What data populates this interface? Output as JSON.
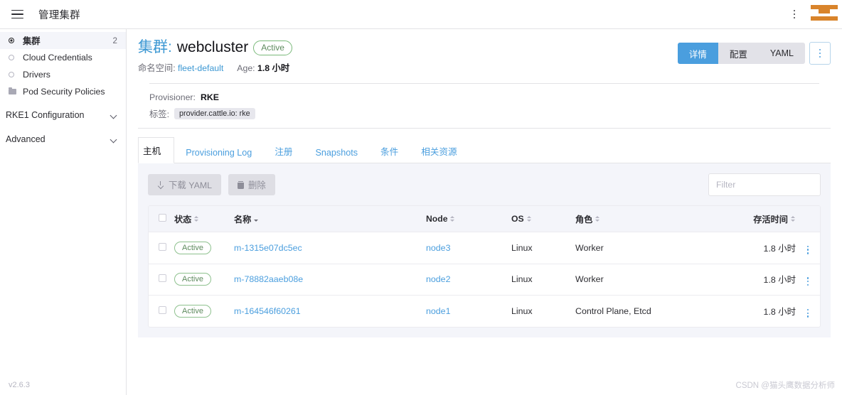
{
  "topbar": {
    "menu_icon": "hamburger-icon",
    "title": "管理集群",
    "kebab_icon": "vertical-dots-icon",
    "logo_icon": "rancher-logo-icon",
    "logo_color": "#d9842b"
  },
  "sidebar": {
    "items": [
      {
        "label": "集群",
        "icon": "cluster-dot-icon",
        "count": "2",
        "active": true
      },
      {
        "label": "Cloud Credentials",
        "icon": "credential-dot-icon",
        "count": "",
        "active": false
      },
      {
        "label": "Drivers",
        "icon": "driver-dot-icon",
        "count": "",
        "active": false
      },
      {
        "label": "Pod Security Policies",
        "icon": "folder-icon",
        "count": "",
        "active": false
      }
    ],
    "groups": [
      {
        "label": "RKE1 Configuration",
        "icon": "chevron-down-icon"
      },
      {
        "label": "Advanced",
        "icon": "chevron-down-icon"
      }
    ],
    "version": "v2.6.3"
  },
  "header": {
    "kind_label": "集群:",
    "resource_name": "webcluster",
    "state_badge": "Active",
    "namespace_label": "命名空间:",
    "namespace_value": "fleet-default",
    "age_label": "Age:",
    "age_value": "1.8 小时",
    "provisioner_label": "Provisioner:",
    "provisioner_value": "RKE",
    "labels_label": "标签:",
    "label_chip": "provider.cattle.io: rke",
    "view_buttons": [
      {
        "label": "详情",
        "active": true
      },
      {
        "label": "配置",
        "active": false
      },
      {
        "label": "YAML",
        "active": false
      }
    ],
    "actions_icon": "vertical-dots-icon"
  },
  "tabs": [
    {
      "label": "主机",
      "active": true
    },
    {
      "label": "Provisioning Log",
      "active": false
    },
    {
      "label": "注册",
      "active": false
    },
    {
      "label": "Snapshots",
      "active": false
    },
    {
      "label": "条件",
      "active": false
    },
    {
      "label": "相关资源",
      "active": false
    }
  ],
  "toolbar": {
    "download_yaml_label": "下载 YAML",
    "download_icon": "download-icon",
    "delete_label": "删除",
    "delete_icon": "trash-icon",
    "filter_placeholder": "Filter",
    "filter_value": ""
  },
  "table": {
    "columns": [
      {
        "key": "state",
        "label": "状态",
        "sortable": true
      },
      {
        "key": "name",
        "label": "名称",
        "sortable": true,
        "sorted": "desc"
      },
      {
        "key": "node",
        "label": "Node",
        "sortable": true
      },
      {
        "key": "os",
        "label": "OS",
        "sortable": true
      },
      {
        "key": "role",
        "label": "角色",
        "sortable": true
      },
      {
        "key": "age",
        "label": "存活时间",
        "sortable": true
      }
    ],
    "rows": [
      {
        "state": "Active",
        "name": "m-1315e07dc5ec",
        "node": "node3",
        "os": "Linux",
        "role": "Worker",
        "age": "1.8 小时"
      },
      {
        "state": "Active",
        "name": "m-78882aaeb08e",
        "node": "node2",
        "os": "Linux",
        "role": "Worker",
        "age": "1.8 小时"
      },
      {
        "state": "Active",
        "name": "m-164546f60261",
        "node": "node1",
        "os": "Linux",
        "role": "Control Plane, Etcd",
        "age": "1.8 小时"
      }
    ],
    "row_action_icon": "vertical-dots-icon"
  },
  "watermark": "CSDN @猫头鹰数据分析师",
  "colors": {
    "accent_blue": "#4a9ede",
    "link_blue": "#3d98d3",
    "state_green": "#5d8a5d",
    "panel_bg": "#f4f5fa",
    "brand_orange": "#d9842b"
  }
}
